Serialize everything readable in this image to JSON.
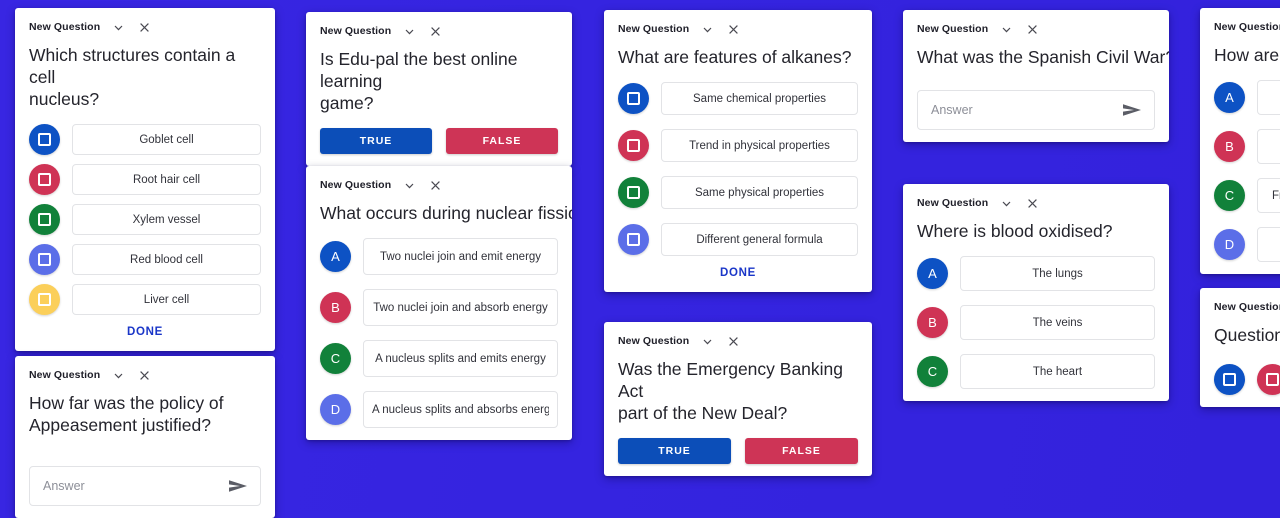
{
  "theme": {
    "background": "#3524e0",
    "card_bg": "#ffffff",
    "done_color": "#1a36c8",
    "true_color": "#0c4eb8",
    "false_color": "#ce3456",
    "badge_colors": {
      "blue": "#0d52c4",
      "crimson": "#cf3355",
      "green": "#11813a",
      "periwinkle": "#5b6ee8",
      "amber": "#fbcf5a"
    }
  },
  "common": {
    "header_title": "New Question",
    "collapse_icon": "chevron-down-icon",
    "close_icon": "close-icon",
    "done_label": "DONE",
    "true_label": "TRUE",
    "false_label": "FALSE",
    "answer_placeholder": "Answer",
    "send_icon": "send-icon"
  },
  "cards": [
    {
      "id": "cell-nucleus",
      "title": "New Question",
      "question": "Which structures contain a cell\nnucleus?",
      "type": "multi-select",
      "options": [
        {
          "badge": "square",
          "color": "#0d52c4",
          "label": "Goblet cell"
        },
        {
          "badge": "square",
          "color": "#cf3355",
          "label": "Root hair cell"
        },
        {
          "badge": "square",
          "color": "#11813a",
          "label": "Xylem vessel"
        },
        {
          "badge": "square",
          "color": "#5b6ee8",
          "label": "Red blood cell"
        },
        {
          "badge": "square",
          "color": "#fbcf5a",
          "label": "Liver cell"
        }
      ],
      "footer": "DONE"
    },
    {
      "id": "appeasement",
      "title": "New Question",
      "question": "How far was the policy of\nAppeasement justified?",
      "type": "open-answer",
      "placeholder": "Answer"
    },
    {
      "id": "edu-pal",
      "title": "New Question",
      "question": "Is Edu-pal the best online learning\ngame?",
      "type": "true-false",
      "true_label": "TRUE",
      "false_label": "FALSE"
    },
    {
      "id": "nuclear-fission",
      "title": "New Question",
      "question": "What occurs during nuclear fission?",
      "type": "multiple-choice",
      "options": [
        {
          "badge": "A",
          "color": "#0d52c4",
          "label": "Two nuclei join and emit energy"
        },
        {
          "badge": "B",
          "color": "#cf3355",
          "label": "Two nuclei join and absorb energy"
        },
        {
          "badge": "C",
          "color": "#11813a",
          "label": "A nucleus splits and emits energy"
        },
        {
          "badge": "D",
          "color": "#5b6ee8",
          "label": "A nucleus splits and absorbs energy"
        }
      ]
    },
    {
      "id": "alkanes",
      "title": "New Question",
      "question": "What are features of alkanes?",
      "type": "multi-select",
      "options": [
        {
          "badge": "square",
          "color": "#0d52c4",
          "label": "Same chemical properties"
        },
        {
          "badge": "square",
          "color": "#cf3355",
          "label": "Trend in physical properties"
        },
        {
          "badge": "square",
          "color": "#11813a",
          "label": "Same physical properties"
        },
        {
          "badge": "square",
          "color": "#5b6ee8",
          "label": "Different general formula"
        }
      ],
      "footer": "DONE"
    },
    {
      "id": "emergency-banking-act",
      "title": "New Question",
      "question": "Was the Emergency Banking Act\npart of the New Deal?",
      "type": "true-false",
      "true_label": "TRUE",
      "false_label": "FALSE"
    },
    {
      "id": "spanish-civil-war",
      "title": "New Question",
      "question": "What was the Spanish Civil War?",
      "type": "open-answer",
      "placeholder": "Answer"
    },
    {
      "id": "blood-oxidised",
      "title": "New Question",
      "question": "Where is blood oxidised?",
      "type": "multiple-choice",
      "options": [
        {
          "badge": "A",
          "color": "#0d52c4",
          "label": "The lungs"
        },
        {
          "badge": "B",
          "color": "#cf3355",
          "label": "The veins"
        },
        {
          "badge": "C",
          "color": "#11813a",
          "label": "The heart"
        }
      ]
    },
    {
      "id": "how-are-a",
      "title": "New Question",
      "question": "How are a",
      "type": "multiple-choice",
      "options": [
        {
          "badge": "A",
          "color": "#0d52c4",
          "label": ""
        },
        {
          "badge": "B",
          "color": "#cf3355",
          "label": ""
        },
        {
          "badge": "C",
          "color": "#11813a",
          "label": "Fr"
        },
        {
          "badge": "D",
          "color": "#5b6ee8",
          "label": ""
        }
      ]
    },
    {
      "id": "question-partial",
      "title": "New Question",
      "question": "Question",
      "type": "multi-select",
      "options": [
        {
          "badge": "square",
          "color": "#0d52c4",
          "label": ""
        },
        {
          "badge": "square",
          "color": "#cf3355",
          "label": ""
        }
      ]
    }
  ]
}
